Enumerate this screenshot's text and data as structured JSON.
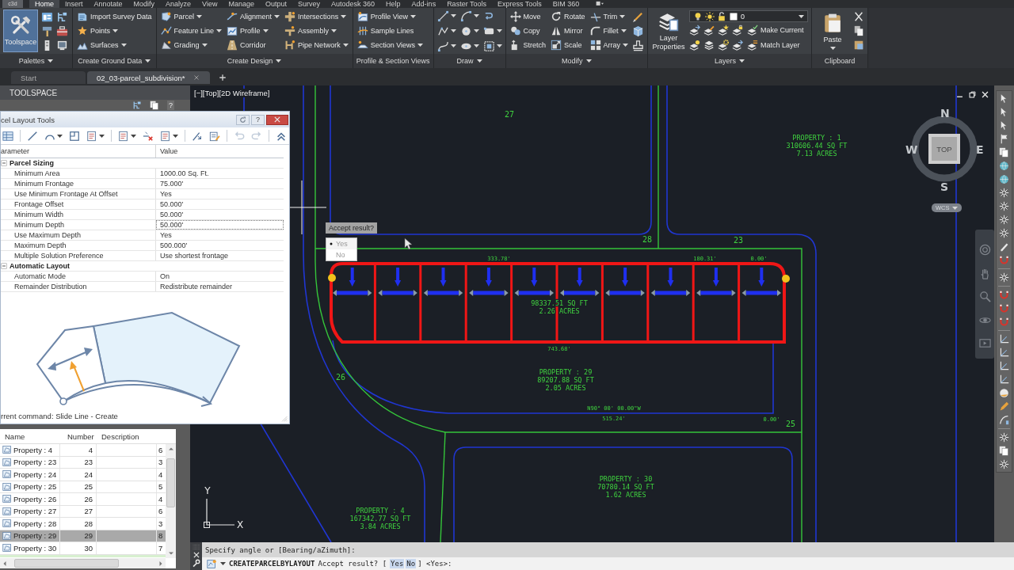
{
  "menu_bar": {
    "app_button": "c3d",
    "tabs": [
      {
        "label": "Home",
        "selected": true
      },
      {
        "label": "Insert",
        "selected": false
      },
      {
        "label": "Annotate",
        "selected": false
      },
      {
        "label": "Modify",
        "selected": false
      },
      {
        "label": "Analyze",
        "selected": false
      },
      {
        "label": "View",
        "selected": false
      },
      {
        "label": "Manage",
        "selected": false
      },
      {
        "label": "Output",
        "selected": false
      },
      {
        "label": "Survey",
        "selected": false
      },
      {
        "label": "Autodesk 360",
        "selected": false
      },
      {
        "label": "Help",
        "selected": false
      },
      {
        "label": "Add-ins",
        "selected": false
      },
      {
        "label": "Raster Tools",
        "selected": false
      },
      {
        "label": "Express Tools",
        "selected": false
      },
      {
        "label": "BIM 360",
        "selected": false
      }
    ]
  },
  "ribbon": {
    "panels": [
      {
        "kind": "palettes",
        "title": "Palettes",
        "has_menu": true,
        "large_button": {
          "label": "Toolspace",
          "on": true
        }
      },
      {
        "kind": "list",
        "title": "Create Ground Data",
        "has_menu": true,
        "columns": [
          [
            {
              "label": "Import Survey Data",
              "dropdown": false
            },
            {
              "label": "Points",
              "dropdown": true
            },
            {
              "label": "Surfaces",
              "dropdown": true
            }
          ]
        ]
      },
      {
        "kind": "list",
        "title": "Create Design",
        "has_menu": true,
        "columns": [
          [
            {
              "label": "Parcel",
              "dropdown": true
            },
            {
              "label": "Feature Line",
              "dropdown": true
            },
            {
              "label": "Grading",
              "dropdown": true
            }
          ],
          [
            {
              "label": "Alignment",
              "dropdown": true
            },
            {
              "label": "Profile",
              "dropdown": true
            },
            {
              "label": "Corridor",
              "dropdown": false
            }
          ],
          [
            {
              "label": "Intersections",
              "dropdown": true
            },
            {
              "label": "Assembly",
              "dropdown": true
            },
            {
              "label": "Pipe Network",
              "dropdown": true
            }
          ]
        ]
      },
      {
        "kind": "list",
        "title": "Profile & Section Views",
        "has_menu": false,
        "columns": [
          [
            {
              "label": "Profile View",
              "dropdown": true
            },
            {
              "label": "Sample Lines",
              "dropdown": false
            },
            {
              "label": "Section Views",
              "dropdown": true
            }
          ]
        ]
      },
      {
        "kind": "draw",
        "title": "Draw",
        "has_menu": true,
        "tools": [
          {
            "dropdown": true
          },
          {
            "dropdown": true
          },
          {
            "dropdown": false
          },
          {
            "dropdown": true
          },
          {
            "dropdown": true
          },
          {
            "dropdown": true
          },
          {
            "dropdown": true
          },
          {
            "dropdown": true
          },
          {
            "dropdown": true
          }
        ]
      },
      {
        "kind": "modify",
        "title": "Modify",
        "has_menu": true,
        "columns": [
          [
            {
              "label": "Move",
              "dropdown": false
            },
            {
              "label": "Copy",
              "dropdown": false
            },
            {
              "label": "Stretch",
              "dropdown": false
            }
          ],
          [
            {
              "label": "Rotate",
              "dropdown": false
            },
            {
              "label": "Mirror",
              "dropdown": false
            },
            {
              "label": "Scale",
              "dropdown": false
            }
          ],
          [
            {
              "label": "Trim",
              "dropdown": true
            },
            {
              "label": "Fillet",
              "dropdown": true
            },
            {
              "label": "Array",
              "dropdown": true
            }
          ]
        ]
      },
      {
        "kind": "layers",
        "title": "Layers",
        "has_menu": true,
        "large_button": {
          "label": "Layer Properties",
          "on": false
        },
        "current_layer": "0",
        "columns": [
          [
            {
              "label": "Make Current",
              "dropdown": false
            },
            {
              "label": "Match Layer",
              "dropdown": false
            }
          ]
        ]
      },
      {
        "kind": "clipboard",
        "title": "Clipboard",
        "has_menu": false,
        "large_button": {
          "label": "Paste",
          "on": false,
          "dropdown": true
        }
      }
    ]
  },
  "file_tabs": [
    {
      "label": "Start",
      "selected": false,
      "closable": false
    },
    {
      "label": "02_03-parcel_subdivision*",
      "selected": true,
      "closable": true
    }
  ],
  "toolspace": {
    "title": "TOOLSPACE",
    "help": "?"
  },
  "parcel_layout_tools": {
    "title": "cel Layout Tools",
    "help": "?",
    "toolbar": [
      {
        "dropdown": false,
        "disabled": false
      },
      {
        "dropdown": false,
        "disabled": false
      },
      {
        "dropdown": true,
        "disabled": false
      },
      {
        "dropdown": false,
        "disabled": false
      },
      {
        "dropdown": true,
        "disabled": false
      },
      {
        "dropdown": true,
        "disabled": false
      },
      {
        "dropdown": false,
        "disabled": false
      },
      {
        "dropdown": true,
        "disabled": false
      },
      {
        "dropdown": false,
        "disabled": false
      },
      {
        "dropdown": false,
        "disabled": false
      },
      {
        "dropdown": false,
        "disabled": true
      },
      {
        "dropdown": false,
        "disabled": true
      },
      {
        "dropdown": false,
        "disabled": false
      }
    ],
    "columns": [
      "arameter",
      "Value"
    ],
    "groups": [
      {
        "label": "Parcel Sizing",
        "expanded": true,
        "rows": [
          {
            "parameter": "Minimum Area",
            "value": "1000.00 Sq. Ft.",
            "selected": false
          },
          {
            "parameter": "Minimum Frontage",
            "value": "75.000'",
            "selected": false
          },
          {
            "parameter": "Use Minimum Frontage At Offset",
            "value": "Yes",
            "selected": false
          },
          {
            "parameter": "Frontage Offset",
            "value": "50.000'",
            "selected": false
          },
          {
            "parameter": "Minimum Width",
            "value": "50.000'",
            "selected": false
          },
          {
            "parameter": "Minimum Depth",
            "value": "50.000'",
            "selected": true
          },
          {
            "parameter": "Use Maximum Depth",
            "value": "Yes",
            "selected": false
          },
          {
            "parameter": "Maximum Depth",
            "value": "500.000'",
            "selected": false
          },
          {
            "parameter": "Multiple Solution Preference",
            "value": "Use shortest frontage",
            "selected": false
          }
        ]
      },
      {
        "label": "Automatic Layout",
        "expanded": true,
        "rows": [
          {
            "parameter": "Automatic Mode",
            "value": "On",
            "selected": false
          },
          {
            "parameter": "Remainder Distribution",
            "value": "Redistribute remainder",
            "selected": false
          }
        ]
      }
    ],
    "status": "rrent command: Slide Line - Create"
  },
  "parcel_list": {
    "columns": [
      "Name",
      "Number",
      "Description"
    ],
    "rows": [
      {
        "name": "Property : 4",
        "number": "4",
        "column_4": "6",
        "selected": false
      },
      {
        "name": "Property : 23",
        "number": "23",
        "column_4": "3",
        "selected": false
      },
      {
        "name": "Property : 24",
        "number": "24",
        "column_4": "4",
        "selected": false
      },
      {
        "name": "Property : 25",
        "number": "25",
        "column_4": "5",
        "selected": false
      },
      {
        "name": "Property : 26",
        "number": "26",
        "column_4": "4",
        "selected": false
      },
      {
        "name": "Property : 27",
        "number": "27",
        "column_4": "6",
        "selected": false
      },
      {
        "name": "Property : 28",
        "number": "28",
        "column_4": "3",
        "selected": false
      },
      {
        "name": "Property : 29",
        "number": "29",
        "column_4": "8",
        "selected": true
      },
      {
        "name": "Property : 30",
        "number": "30",
        "column_4": "7",
        "selected": false
      }
    ]
  },
  "viewport": {
    "view_controls": [
      "[−]",
      "[Top]",
      "[2D Wireframe]"
    ],
    "lot_numbers": [
      "27",
      "28",
      "23",
      "26",
      "25"
    ],
    "parcel_labels": [
      {
        "lines": [
          "PROPERTY : 1",
          "310606.44 SQ FT",
          "7.13 ACRES"
        ]
      },
      {
        "lines": [
          "98337.51 SQ FT",
          "2.26 ACRES"
        ]
      },
      {
        "lines": [
          "PROPERTY : 29",
          "89207.88 SQ FT",
          "2.05 ACRES"
        ]
      },
      {
        "lines": [
          "PROPERTY : 30",
          "70780.14 SQ FT",
          "1.62 ACRES"
        ]
      },
      {
        "lines": [
          "PROPERTY : 4",
          "167342.77 SQ FT",
          "3.84 ACRES"
        ]
      }
    ],
    "dimension_labels": [
      "333.78'",
      "180.31'",
      "0.00'",
      "743.68'",
      "N90° 00' 00.00\"W",
      "515.24'",
      "0.00'"
    ],
    "viewcube": {
      "face": "TOP",
      "north": "N",
      "south": "S",
      "west": "W",
      "east": "E",
      "coordinate_system": "WCS"
    },
    "ucs_axes": {
      "x": "X",
      "y": "Y"
    },
    "prompt": {
      "label": "Accept result?",
      "options": [
        {
          "label": "Yes",
          "selected": true
        },
        {
          "label": "No",
          "selected": false
        }
      ]
    }
  },
  "command_line": {
    "history": "Specify angle or [Bearing/aZimuth]:",
    "command": "CREATEPARCELBYLAYOUT",
    "prompt": "Accept result? [",
    "options": [
      "Yes",
      "No"
    ],
    "default": "] <Yes>:"
  }
}
